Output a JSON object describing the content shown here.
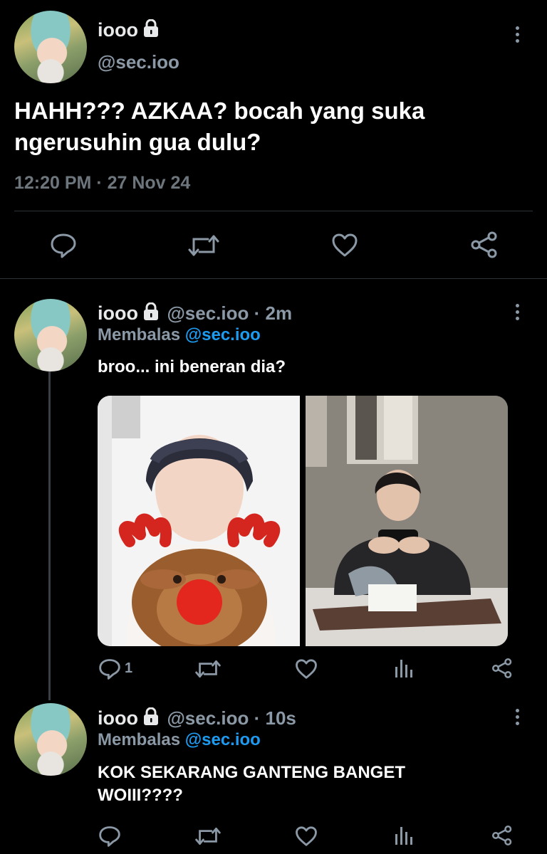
{
  "main_tweet": {
    "name": "iooo",
    "handle": "@sec.ioo",
    "text_line1": "HAHH??? AZKAA? bocah yang suka",
    "text_line2": "ngerusuhin gua dulu?",
    "timestamp": "12:20 PM · 27 Nov 24"
  },
  "reply1": {
    "name": "iooo",
    "handle_time": "@sec.ioo · 2m",
    "replying_prefix": "Membalas",
    "replying_to": "@sec.ioo",
    "text": "broo... ini beneran dia?",
    "reply_count": "1"
  },
  "reply2": {
    "name": "iooo",
    "handle_time": "@sec.ioo · 10s",
    "replying_prefix": "Membalas",
    "replying_to": "@sec.ioo",
    "text_line1": "KOK SEKARANG GANTENG BANGET",
    "text_line2": "WOIII????"
  },
  "icons": [
    "lock-icon",
    "more-icon",
    "reply-icon",
    "retweet-icon",
    "like-icon",
    "share-icon",
    "analytics-icon"
  ],
  "colors": {
    "background": "#000000",
    "link": "#1d9bf0",
    "muted": "#8b98a5",
    "icon": "#8b98a5",
    "divider": "#2f3336"
  }
}
